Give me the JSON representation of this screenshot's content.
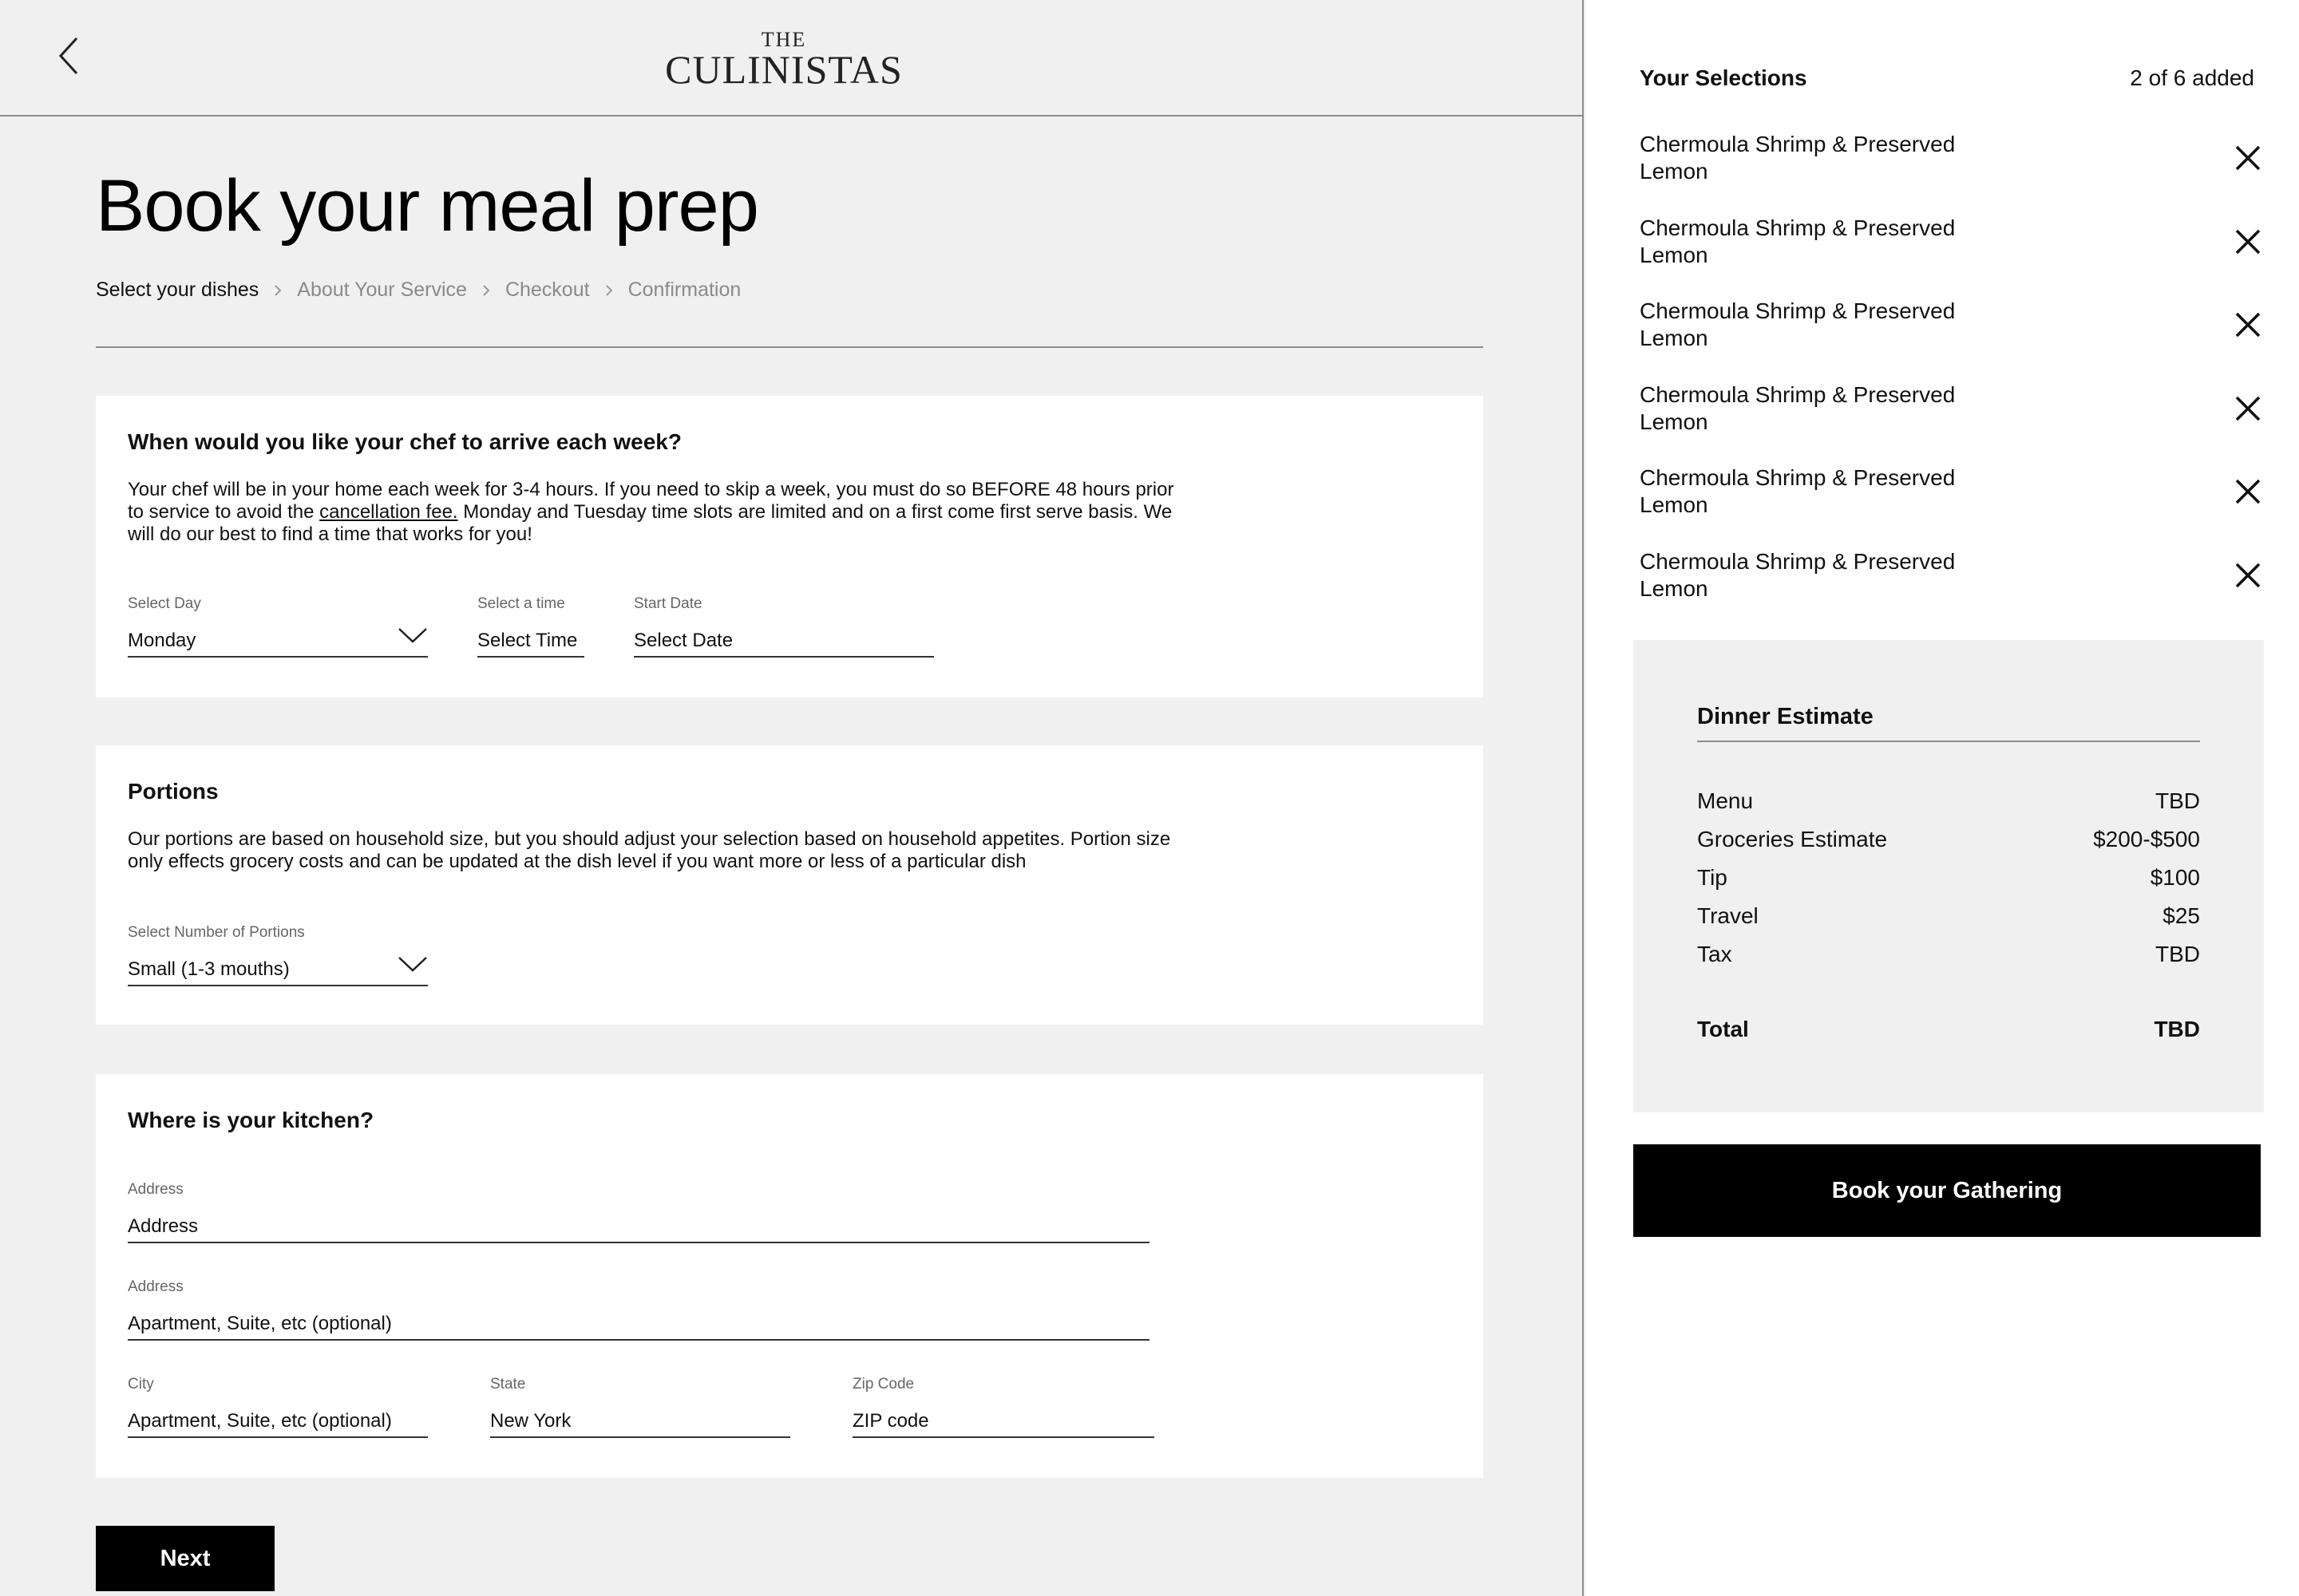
{
  "header": {
    "logo_top": "THE",
    "logo_name": "CULINISTAS"
  },
  "page": {
    "title": "Book your meal prep"
  },
  "breadcrumb": [
    {
      "label": "Select your dishes",
      "active": true
    },
    {
      "label": "About Your Service",
      "active": false
    },
    {
      "label": "Checkout",
      "active": false
    },
    {
      "label": "Confirmation",
      "active": false
    }
  ],
  "schedule": {
    "title": "When would you like your chef to arrive each week?",
    "body_1": "Your chef will be in your home each week for 3-4 hours. If you need to skip a week, you must do so BEFORE 48 hours prior to service to avoid the ",
    "link": "cancellation fee.",
    "body_2": " Monday and Tuesday time slots are limited and on a first come first serve basis. We will do our best to find a time that works for you!",
    "day_label": "Select Day",
    "day_value": "Monday",
    "time_label": "Select a time",
    "time_value": "Select Time",
    "date_label": "Start Date",
    "date_value": "Select Date"
  },
  "portions": {
    "title": "Portions",
    "body": "Our portions are based on household size, but you should adjust your selection based on household appetites. Portion size only effects grocery costs and can be updated at the dish level if you want more or less of a particular dish",
    "label": "Select Number of Portions",
    "value": "Small (1-3 mouths)"
  },
  "kitchen": {
    "title": "Where is your kitchen?",
    "address1_label": "Address",
    "address1_value": "Address",
    "address2_label": "Address",
    "address2_value": "Apartment, Suite, etc (optional)",
    "city_label": "City",
    "city_value": "Apartment, Suite, etc (optional)",
    "state_label": "State",
    "state_value": "New York",
    "zip_label": "Zip Code",
    "zip_value": "ZIP code"
  },
  "next_label": "Next",
  "selections": {
    "title": "Your Selections",
    "count": "2 of 6 added",
    "items": [
      {
        "line1": "Chermoula Shrimp & Preserved",
        "line2": "Lemon"
      },
      {
        "line1": "Chermoula Shrimp & Preserved",
        "line2": "Lemon"
      },
      {
        "line1": "Chermoula Shrimp & Preserved",
        "line2": "Lemon"
      },
      {
        "line1": "Chermoula Shrimp & Preserved",
        "line2": "Lemon"
      },
      {
        "line1": "Chermoula Shrimp & Preserved",
        "line2": "Lemon"
      },
      {
        "line1": "Chermoula Shrimp & Preserved",
        "line2": "Lemon"
      }
    ]
  },
  "estimate": {
    "title": "Dinner Estimate",
    "rows": [
      {
        "label": "Menu",
        "value": "TBD"
      },
      {
        "label": "Groceries Estimate",
        "value": "$200-$500"
      },
      {
        "label": "Tip",
        "value": "$100"
      },
      {
        "label": "Travel",
        "value": "$25"
      },
      {
        "label": "Tax",
        "value": "TBD"
      }
    ],
    "total_label": "Total",
    "total_value": "TBD"
  },
  "book_label": "Book your Gathering"
}
